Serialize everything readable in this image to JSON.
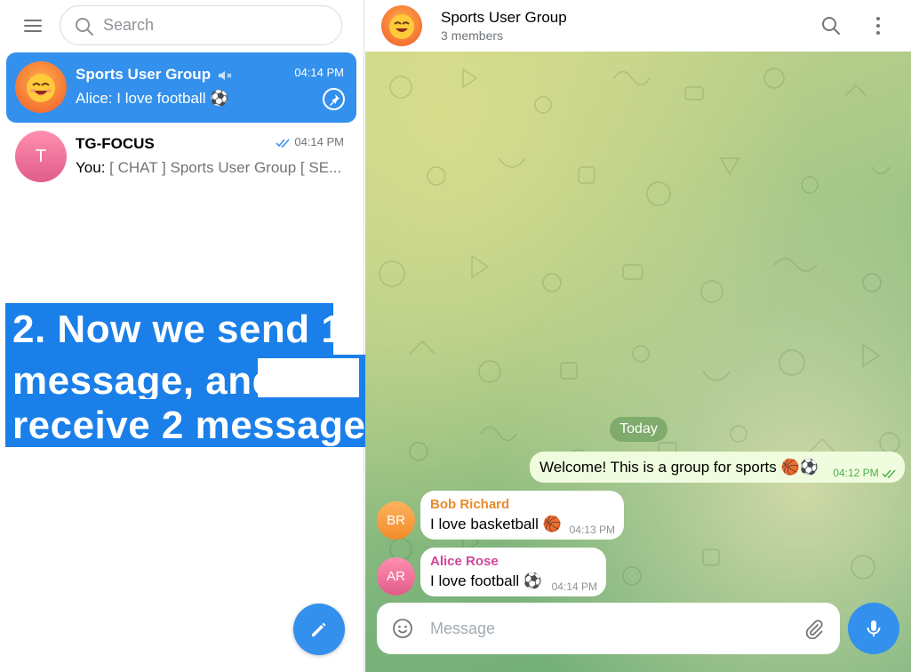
{
  "sidebar": {
    "search_placeholder": "Search",
    "chats": [
      {
        "name": "Sports User Group",
        "last_message": "Alice: I love football ⚽",
        "time": "04:14 PM",
        "muted": true,
        "pinned": true,
        "active": true,
        "avatar_icon": "smiling-face-avatar"
      },
      {
        "name": "TG-FOCUS",
        "avatar_letter": "T",
        "last_prefix": "You:",
        "last_message": "[ CHAT ] Sports User Group [ SE...",
        "time": "04:14 PM",
        "read_status": "double-check",
        "active": false
      }
    ],
    "overlay_caption": {
      "line1": "2.  Now we send 1",
      "line2": "message, and",
      "line3": "receive 2 messages."
    }
  },
  "chat": {
    "title": "Sports User Group",
    "subtitle": "3 members",
    "date_chip": "Today",
    "messages": [
      {
        "direction": "out",
        "text": "Welcome! This is a group for sports 🏀⚽",
        "time": "04:12 PM",
        "status": "read"
      },
      {
        "direction": "in",
        "sender": "Bob Richard",
        "sender_color": "#e88b2d",
        "initials": "BR",
        "text": "I love basketball 🏀",
        "time": "04:13 PM"
      },
      {
        "direction": "in",
        "sender": "Alice Rose",
        "sender_color": "#d0479a",
        "initials": "AR",
        "text": "I love football ⚽",
        "time": "04:14 PM"
      }
    ],
    "composer_placeholder": "Message"
  },
  "colors": {
    "accent": "#3390ec",
    "outgoing_bubble": "#effdde",
    "overlay_blue": "#1a7fe8"
  }
}
